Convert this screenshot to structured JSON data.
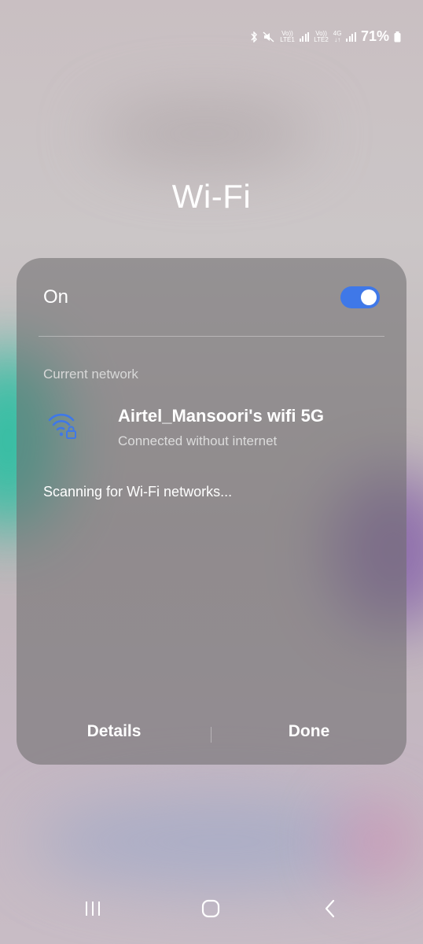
{
  "status_bar": {
    "lte1": "LTE1",
    "lte2": "LTE2",
    "vol": "Vo))",
    "network": "4G",
    "battery": "71%"
  },
  "screen": {
    "title": "Wi-Fi"
  },
  "panel": {
    "toggle_label": "On",
    "toggle_state": true,
    "section_label": "Current network",
    "network_name": "Airtel_Mansoori's wifi 5G",
    "network_status": "Connected without internet",
    "scan_text": "Scanning for Wi-Fi networks...",
    "details_button": "Details",
    "done_button": "Done"
  },
  "icons": {
    "wifi": "wifi-lock-icon",
    "bluetooth": "bluetooth-icon",
    "mute": "mute-icon",
    "recent": "recent-apps-icon",
    "home": "home-icon",
    "back": "back-icon"
  },
  "colors": {
    "accent": "#3f78e8",
    "panel": "#6e6c6e"
  }
}
